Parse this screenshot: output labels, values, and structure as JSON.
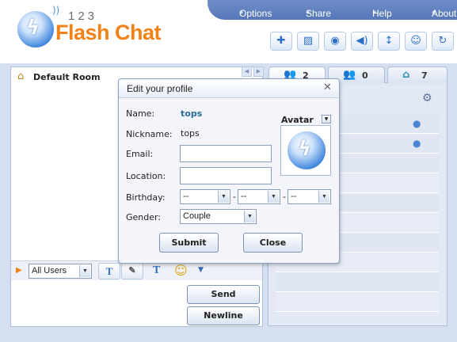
{
  "app": {
    "logo_number": "123",
    "logo_text": "Flash Chat"
  },
  "topnav": {
    "items": [
      "Options",
      "Share",
      "Help",
      "About"
    ]
  },
  "toolbar_icons": [
    "gamepad-icon",
    "image-icon",
    "webcam-icon",
    "speaker-icon",
    "resize-icon",
    "smiley-bubble-icon",
    "refresh-icon"
  ],
  "room": {
    "name": "Default Room"
  },
  "tabs": [
    {
      "icon": "users-icon",
      "count": "2"
    },
    {
      "icon": "add-users-icon",
      "count": "0"
    },
    {
      "icon": "home-icon",
      "count": "7"
    }
  ],
  "input": {
    "recipient": "All Users",
    "send_label": "Send",
    "newline_label": "Newline"
  },
  "dialog": {
    "title": "Edit your profile",
    "name_label": "Name:",
    "name_value": "tops",
    "nickname_label": "Nickname:",
    "nickname_value": "tops",
    "email_label": "Email:",
    "email_value": "",
    "location_label": "Location:",
    "location_value": "",
    "birthday_label": "Birthday:",
    "birthday_month": "--",
    "birthday_day": "--",
    "birthday_year": "--",
    "birthday_sep": "-",
    "gender_label": "Gender:",
    "gender_value": "Couple",
    "avatar_label": "Avatar",
    "submit_label": "Submit",
    "close_label": "Close"
  },
  "colors": {
    "accent": "#f08217",
    "header_nav": "#5677b8",
    "panel": "#d6dff0"
  }
}
